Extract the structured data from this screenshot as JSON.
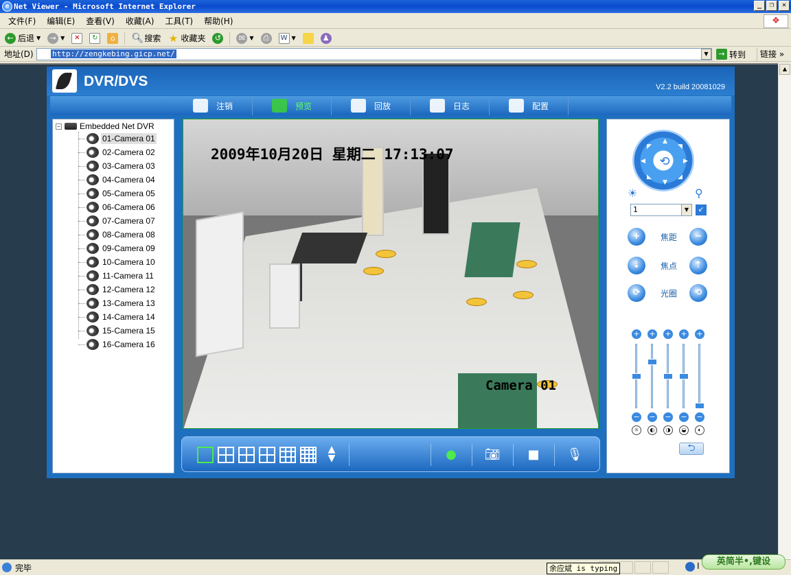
{
  "window": {
    "title": "Net Viewer - Microsoft Internet Explorer",
    "buttons": [
      "_",
      "❐",
      "✕"
    ]
  },
  "menu": [
    "文件(F)",
    "编辑(E)",
    "查看(V)",
    "收藏(A)",
    "工具(T)",
    "帮助(H)"
  ],
  "toolbar": {
    "back": "后退",
    "search": "搜索",
    "favorites": "收藏夹"
  },
  "address": {
    "label": "地址(D)",
    "url": "http://zengkebing.gicp.net/",
    "go": "转到",
    "links": "链接"
  },
  "app": {
    "title": "DVR/DVS",
    "version": "V2.2  build 20081029",
    "nav": [
      {
        "label": "注销",
        "icon": "logout-icon",
        "active": false
      },
      {
        "label": "预览",
        "icon": "preview-monitor-icon",
        "active": true
      },
      {
        "label": "回放",
        "icon": "playback-film-icon",
        "active": false
      },
      {
        "label": "日志",
        "icon": "log-icon",
        "active": false
      },
      {
        "label": "配置",
        "icon": "config-tools-icon",
        "active": false
      }
    ],
    "tree": {
      "root": "Embedded Net DVR",
      "expand_symbol": "−",
      "cameras": [
        "01-Camera 01",
        "02-Camera 02",
        "03-Camera 03",
        "04-Camera 04",
        "05-Camera 05",
        "06-Camera 06",
        "07-Camera 07",
        "08-Camera 08",
        "09-Camera 09",
        "10-Camera 10",
        "11-Camera 11",
        "12-Camera 12",
        "13-Camera 13",
        "14-Camera 14",
        "15-Camera 15",
        "16-Camera 16"
      ],
      "selected_index": 0
    },
    "video": {
      "osd_time": "2009年10月20日 星期二 17:13:07",
      "osd_camera": "Camera 01"
    },
    "ptz": {
      "preset_value": "1",
      "zoom_label": "焦距",
      "focus_label": "焦点",
      "iris_label": "光圈",
      "sliders": [
        {
          "name": "brightness",
          "level": 0.5
        },
        {
          "name": "contrast",
          "level": 0.75
        },
        {
          "name": "saturation",
          "level": 0.5
        },
        {
          "name": "hue",
          "level": 0.5
        },
        {
          "name": "volume",
          "level": 0.0
        }
      ]
    }
  },
  "status": {
    "text": "完毕",
    "zone": "I",
    "ime_tip": "余应斌 is typing",
    "ime_bar": "英简半•,键设"
  }
}
